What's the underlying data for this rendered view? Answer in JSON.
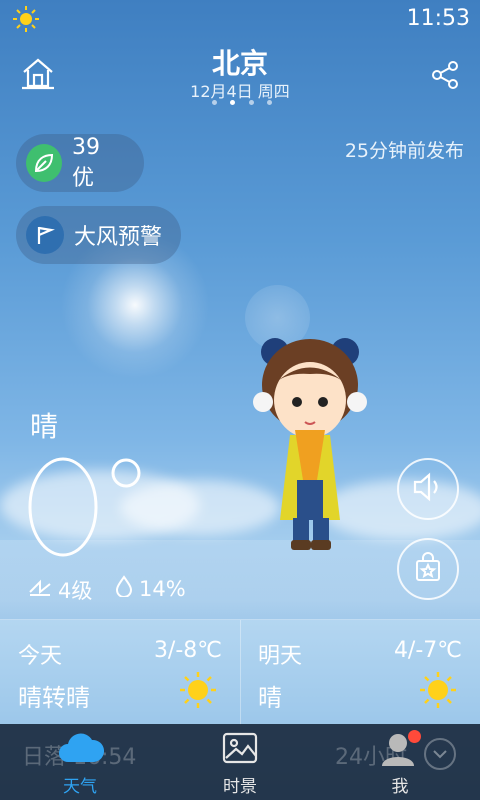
{
  "status_bar": {
    "time": "11:53"
  },
  "header": {
    "city": "北京",
    "date_line": "12月4日 周四",
    "page_count": 4,
    "active_page": 2
  },
  "publish_note": "25分钟前发布",
  "air_quality": {
    "value": "39 优"
  },
  "warning": {
    "label": "大风预警"
  },
  "current": {
    "condition": "晴",
    "temperature": "0",
    "wind": "4级",
    "humidity": "14%"
  },
  "forecast": {
    "today": {
      "day": "今天",
      "temp": "3/-8℃",
      "condition": "晴转晴"
    },
    "tomorrow": {
      "day": "明天",
      "temp": "4/-7℃",
      "condition": "晴"
    }
  },
  "tabbar": {
    "ghost_left": "日落 16:54",
    "ghost_right": "24小时",
    "tabs": [
      {
        "label": "天气"
      },
      {
        "label": "时景"
      },
      {
        "label": "我"
      }
    ]
  },
  "colors": {
    "accent_blue": "#2fa3f2",
    "aqi_green": "#3fbf6f",
    "sun_yellow": "#ffd11a",
    "badge_red": "#ff4a3a"
  }
}
